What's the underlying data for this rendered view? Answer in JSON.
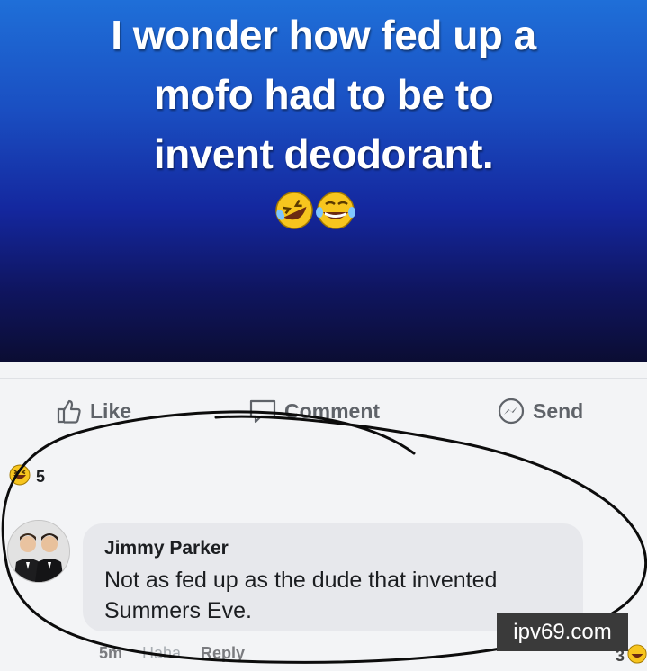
{
  "post": {
    "headline_lines": [
      "I wonder how fed up a",
      "mofo had to be to",
      "invent deodorant."
    ],
    "emoji_icons": [
      "rolling-on-floor-laughing-emoji",
      "tears-of-joy-emoji"
    ],
    "colors": {
      "gradient_top": "#1f6fd8",
      "gradient_bottom": "#0b0d33"
    }
  },
  "actions": {
    "like_label": "Like",
    "comment_label": "Comment",
    "send_label": "Send"
  },
  "reactions": {
    "icon": "haha-reaction-icon",
    "count": "5"
  },
  "comment": {
    "author": "Jimmy Parker",
    "text": "Not as fed up as the dude that invented Summers Eve.",
    "time": "5m",
    "haha_label": "Haha",
    "reply_label": "Reply",
    "reaction_count": "3"
  },
  "watermark": {
    "text": "ipv69.com"
  }
}
